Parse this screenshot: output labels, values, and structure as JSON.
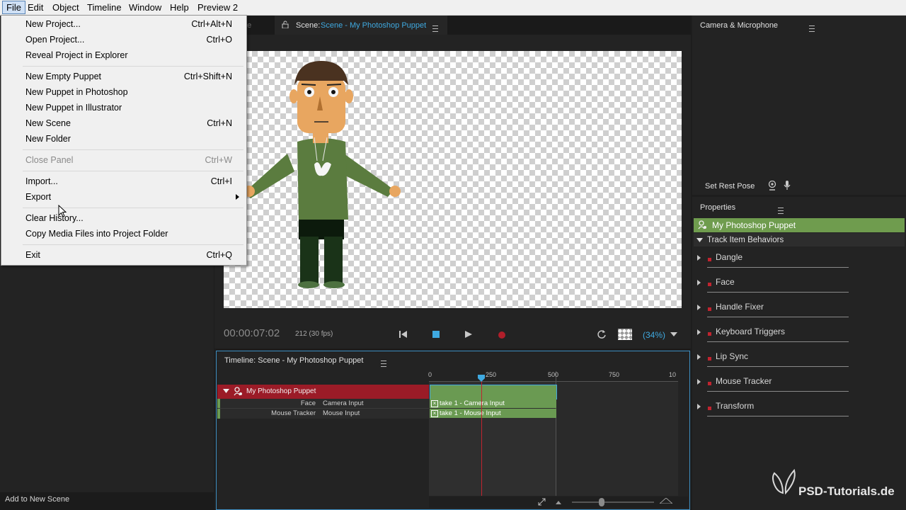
{
  "menubar": {
    "items": [
      "File",
      "Edit",
      "Object",
      "Timeline",
      "Window",
      "Help",
      "Preview 2"
    ]
  },
  "file_menu": {
    "items": [
      {
        "label": "New Project...",
        "shortcut": "Ctrl+Alt+N"
      },
      {
        "label": "Open Project...",
        "shortcut": "Ctrl+O"
      },
      {
        "label": "Reveal Project in Explorer",
        "shortcut": ""
      },
      {
        "label": "New Empty Puppet",
        "shortcut": "Ctrl+Shift+N"
      },
      {
        "label": "New Puppet in Photoshop",
        "shortcut": ""
      },
      {
        "label": "New Puppet in Illustrator",
        "shortcut": ""
      },
      {
        "label": "New Scene",
        "shortcut": "Ctrl+N"
      },
      {
        "label": "New Folder",
        "shortcut": ""
      },
      {
        "label": "Close Panel",
        "shortcut": "Ctrl+W"
      },
      {
        "label": "Import...",
        "shortcut": "Ctrl+I"
      },
      {
        "label": "Export",
        "shortcut": ""
      },
      {
        "label": "Clear History...",
        "shortcut": ""
      },
      {
        "label": "Copy Media Files into Project Folder",
        "shortcut": ""
      },
      {
        "label": "Exit",
        "shortcut": "Ctrl+Q"
      }
    ]
  },
  "left_panel": {
    "add_to_new_scene": "Add to New Scene"
  },
  "scene_tabs": {
    "tab_partial": "me",
    "scene_prefix": "Scene:",
    "scene_name": "Scene - My Photoshop Puppet"
  },
  "transport": {
    "timecode": "00:00:07:02",
    "frame_info": "212 (30 fps)",
    "zoom": "(34%)"
  },
  "timeline": {
    "title": "Timeline: Scene - My Photoshop Puppet",
    "ticks": [
      "0",
      "250",
      "500",
      "750",
      "10"
    ],
    "playhead_frame": "212",
    "puppet_track": "My Photoshop Puppet",
    "rows": [
      {
        "behavior": "Face",
        "input": "Camera Input",
        "take": "take 1 - Camera Input"
      },
      {
        "behavior": "Mouse Tracker",
        "input": "Mouse Input",
        "take": "take 1 - Mouse Input"
      }
    ]
  },
  "camera_panel": {
    "title": "Camera & Microphone",
    "set_rest_pose": "Set Rest Pose"
  },
  "properties": {
    "title": "Properties",
    "puppet_name": "My Photoshop Puppet",
    "section": "Track Item Behaviors",
    "behaviors": [
      "Dangle",
      "Face",
      "Handle Fixer",
      "Keyboard Triggers",
      "Lip Sync",
      "Mouse Tracker",
      "Transform"
    ]
  },
  "watermark": {
    "text": "PSD-Tutorials.de"
  },
  "colors": {
    "accent_blue": "#3fa9e0",
    "track_red": "#9b1b27",
    "track_green": "#6a9a52",
    "props_green": "#6f9c4e",
    "record_red": "#b01e2a"
  }
}
